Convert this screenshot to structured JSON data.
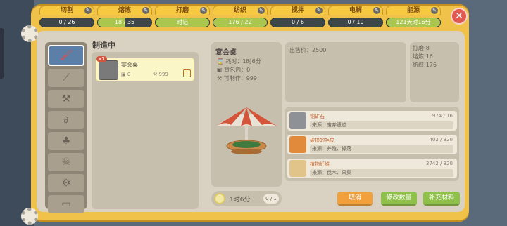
{
  "resources": [
    {
      "label": "切割",
      "value": "0 / 26",
      "fill": 0
    },
    {
      "label": "熔炼",
      "value": "18 / 35",
      "fill": 0.51
    },
    {
      "label": "打磨",
      "value": "时记",
      "fill": 1
    },
    {
      "label": "纺织",
      "value": "176 / 22",
      "fill": 1
    },
    {
      "label": "搅拌",
      "value": "0 / 6",
      "fill": 0
    },
    {
      "label": "电解",
      "value": "0 / 10",
      "fill": 0
    },
    {
      "label": "能源",
      "value": "121天时16分",
      "fill": 1
    }
  ],
  "list": {
    "title": "制造中",
    "item": {
      "name": "宴会桌",
      "badge": "x1",
      "pack": "0",
      "cancraft": "999"
    }
  },
  "detail": {
    "title": "宴会桌",
    "time_label": "耗时：",
    "time_value": "1时6分",
    "pack_label": "背包内：",
    "pack_value": "0",
    "craft_label": "可制作：",
    "craft_value": "999"
  },
  "price": "出售价：2500",
  "attrs": [
    "打磨:8",
    "熔炼:16",
    "纺织:176"
  ],
  "materials": [
    {
      "name": "铜矿石",
      "count": "974 / 16",
      "source": "来源：废弃遗迹",
      "icon_color": "#8e9296"
    },
    {
      "name": "破损的毛皮",
      "count": "402 / 320",
      "source": "来源：养殖、掉落",
      "icon_color": "#e28a3c"
    },
    {
      "name": "植物纤维",
      "count": "3742 / 320",
      "source": "来源：伐木、采集",
      "icon_color": "#e0c48a"
    }
  ],
  "timer": {
    "time": "1时6分",
    "count": "0 / 1"
  },
  "buttons": {
    "cancel": "取消",
    "modify": "修改数量",
    "refill": "补充材料"
  },
  "colors": {
    "frame": "#f1c24a",
    "accent_green": "#8fc04a",
    "accent_orange": "#f2a03c",
    "close": "#e05a52"
  }
}
